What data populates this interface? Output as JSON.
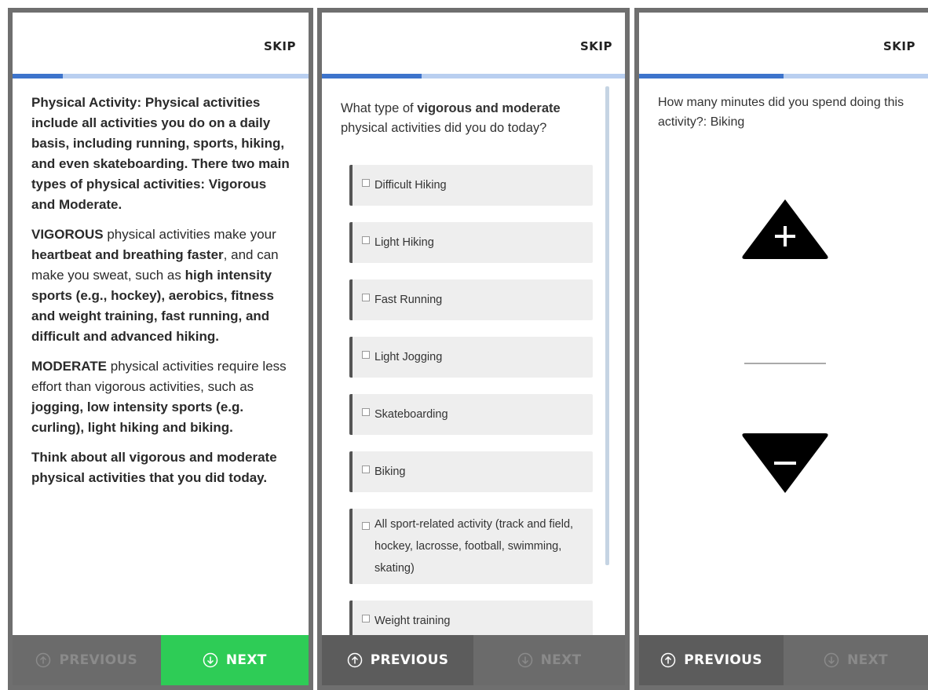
{
  "screens": [
    {
      "skip": "SKIP",
      "progress_fraction": 0.17,
      "intro": {
        "p1": "Physical Activity: Physical activities include all activities you do on a daily basis, including running, sports, hiking, and even skateboarding. There two main types of physical activities: Vigorous and Moderate.",
        "p2_a": "VIGOROUS",
        "p2_b": " physical activities make your ",
        "p2_c": "heartbeat and breathing faster",
        "p2_d": ", and can make you sweat, such as ",
        "p2_e": "high intensity sports (e.g., hockey), aerobics, fitness and weight training, fast running, and difficult and advanced hiking.",
        "p3_a": "MODERATE",
        "p3_b": " physical activities require less effort than vigorous activities, such as ",
        "p3_c": "jogging, low intensity sports (e.g. curling), light hiking and biking.",
        "p4": "Think about all vigorous and moderate physical activities that you did today."
      },
      "prev_label": "PREVIOUS",
      "next_label": "NEXT",
      "colors": {
        "next_bg": "#2ecc56"
      }
    },
    {
      "skip": "SKIP",
      "progress_fraction": 0.33,
      "question_a": "What type of ",
      "question_b": "vigorous and moderate",
      "question_c": " physical activities did you do today?",
      "options": [
        "Difficult Hiking",
        "Light Hiking",
        "Fast Running",
        "Light Jogging",
        "Skateboarding",
        "Biking",
        "All sport-related activity (track and field, hockey, lacrosse, football, swimming, skating)",
        "Weight training"
      ],
      "prev_label": "PREVIOUS",
      "next_label": "NEXT"
    },
    {
      "skip": "SKIP",
      "progress_fraction": 0.5,
      "question": "How many minutes did you spend doing this activity?: Biking",
      "increment_icon": "plus-triangle-icon",
      "decrement_icon": "minus-triangle-icon",
      "prev_label": "PREVIOUS",
      "next_label": "NEXT"
    }
  ],
  "colors": {
    "accent": "#3d74cc",
    "progress_track": "#b9cff0",
    "nav_bg": "#6b6b6b",
    "green": "#2ecc56"
  }
}
